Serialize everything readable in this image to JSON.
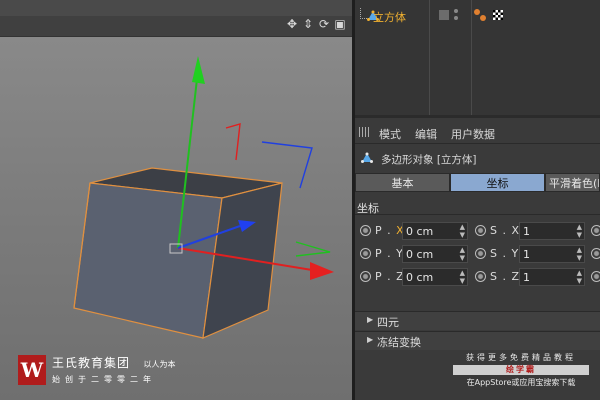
{
  "viewport": {
    "toolbar_icons": [
      "move-view-icon",
      "zoom-view-icon",
      "rotate-view-icon",
      "maximize-view-icon"
    ]
  },
  "object_manager": {
    "object_name": "立方体"
  },
  "attributes": {
    "menu": [
      "模式",
      "编辑",
      "用户数据"
    ],
    "object_title": "多边形对象 [立方体]",
    "tabs": [
      "基本",
      "坐标",
      "平滑着色(P"
    ],
    "active_tab": "坐标",
    "section_title": "坐标",
    "rows": [
      {
        "left_label_prefix": "P . ",
        "left_label_axis": "X",
        "left_value": "0 cm",
        "right_label": "S . X",
        "right_value": "1"
      },
      {
        "left_label_prefix": "P . ",
        "left_label_axis": "Y",
        "left_value": "0 cm",
        "right_label": "S . Y",
        "right_value": "1"
      },
      {
        "left_label_prefix": "P . ",
        "left_label_axis": "Z",
        "left_value": "0 cm",
        "right_label": "S . Z",
        "right_value": "1"
      }
    ],
    "groups": [
      "四元",
      "冻结变换"
    ]
  },
  "logo": {
    "mark": "W",
    "title": "王氏教育集团",
    "tagline": "以人为本",
    "subtitle": "始创于二零零二年"
  },
  "promo": {
    "line1": "获得更多免费精品教程",
    "badge": "绘学霸",
    "line3": "在AppStore或应用宝搜索下载"
  },
  "colors": {
    "accent_orange": "#f0b030",
    "active_tab": "#8aa8d0",
    "axis_x": "#e02020",
    "axis_y": "#20c020",
    "axis_z": "#2040e0",
    "logo_red": "#b01c1c"
  }
}
